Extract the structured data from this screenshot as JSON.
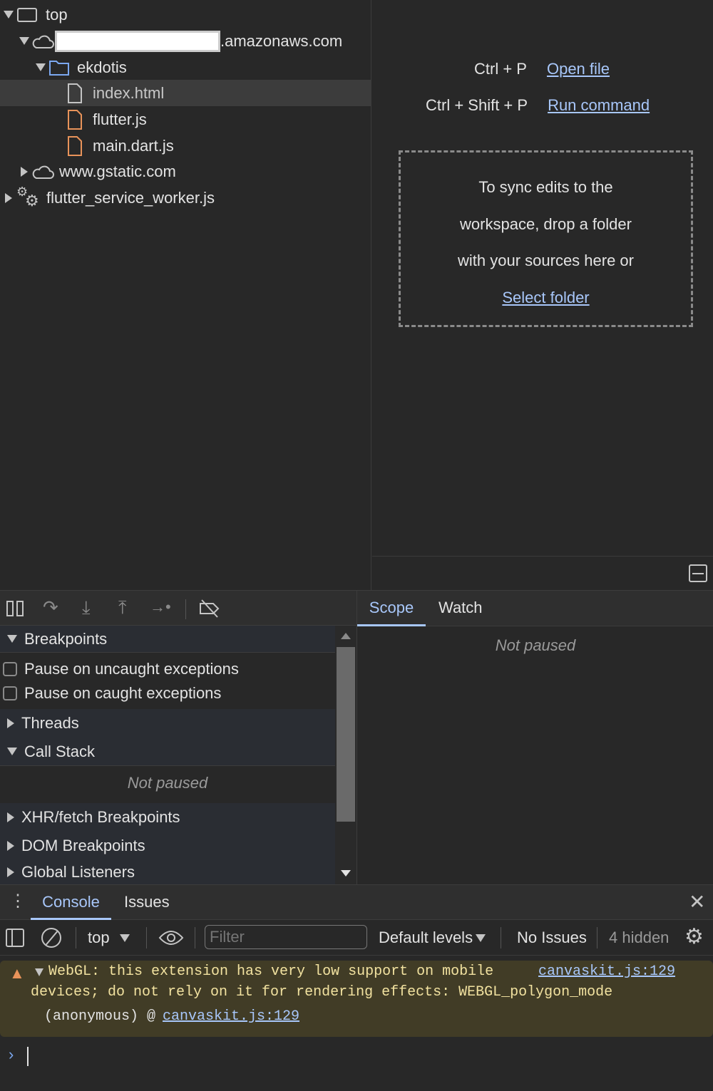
{
  "navigator": {
    "items": [
      {
        "label": "top",
        "icon": "frame-icon"
      },
      {
        "label": ".amazonaws.com",
        "icon": "cloud-icon"
      },
      {
        "label": "ekdotis",
        "icon": "folder-icon"
      },
      {
        "label": "index.html",
        "icon": "file-icon"
      },
      {
        "label": "flutter.js",
        "icon": "file-icon"
      },
      {
        "label": "main.dart.js",
        "icon": "file-icon"
      },
      {
        "label": "www.gstatic.com",
        "icon": "cloud-icon"
      },
      {
        "label": "flutter_service_worker.js",
        "icon": "gears-icon"
      }
    ]
  },
  "editor": {
    "shortcut1": "Ctrl + P",
    "action1": "Open file",
    "shortcut2": "Ctrl + Shift + P",
    "action2": "Run command",
    "drop_lines": [
      "To sync edits to the",
      "workspace, drop a folder",
      "with your sources here or"
    ],
    "select_folder": "Select folder"
  },
  "debugger": {
    "sections": {
      "breakpoints": "Breakpoints",
      "pause_uncaught": "Pause on uncaught exceptions",
      "pause_caught": "Pause on caught exceptions",
      "threads": "Threads",
      "call_stack": "Call Stack",
      "not_paused": "Not paused",
      "xhr": "XHR/fetch Breakpoints",
      "dom": "DOM Breakpoints",
      "global": "Global Listeners"
    },
    "tabs": [
      "Scope",
      "Watch"
    ],
    "scope_text": "Not paused"
  },
  "drawer": {
    "tabs": [
      "Console",
      "Issues"
    ],
    "context": "top",
    "filter_placeholder": "Filter",
    "levels": "Default levels",
    "issues": "No Issues",
    "hidden": "4 hidden"
  },
  "console": {
    "warning_line1": "WebGL: this extension has very low support on mobile",
    "warning_line2": "devices; do not rely on it for rendering effects: WEBGL_polygon_mode",
    "source": "canvaskit.js:129",
    "stack_prefix": "(anonymous) @",
    "stack_link": "canvaskit.js:129"
  },
  "colors": {
    "accent": "#a8c7fa",
    "warning_bg": "#413c26",
    "warning_text": "#f2e2a0",
    "file_orange": "#e8935a"
  }
}
